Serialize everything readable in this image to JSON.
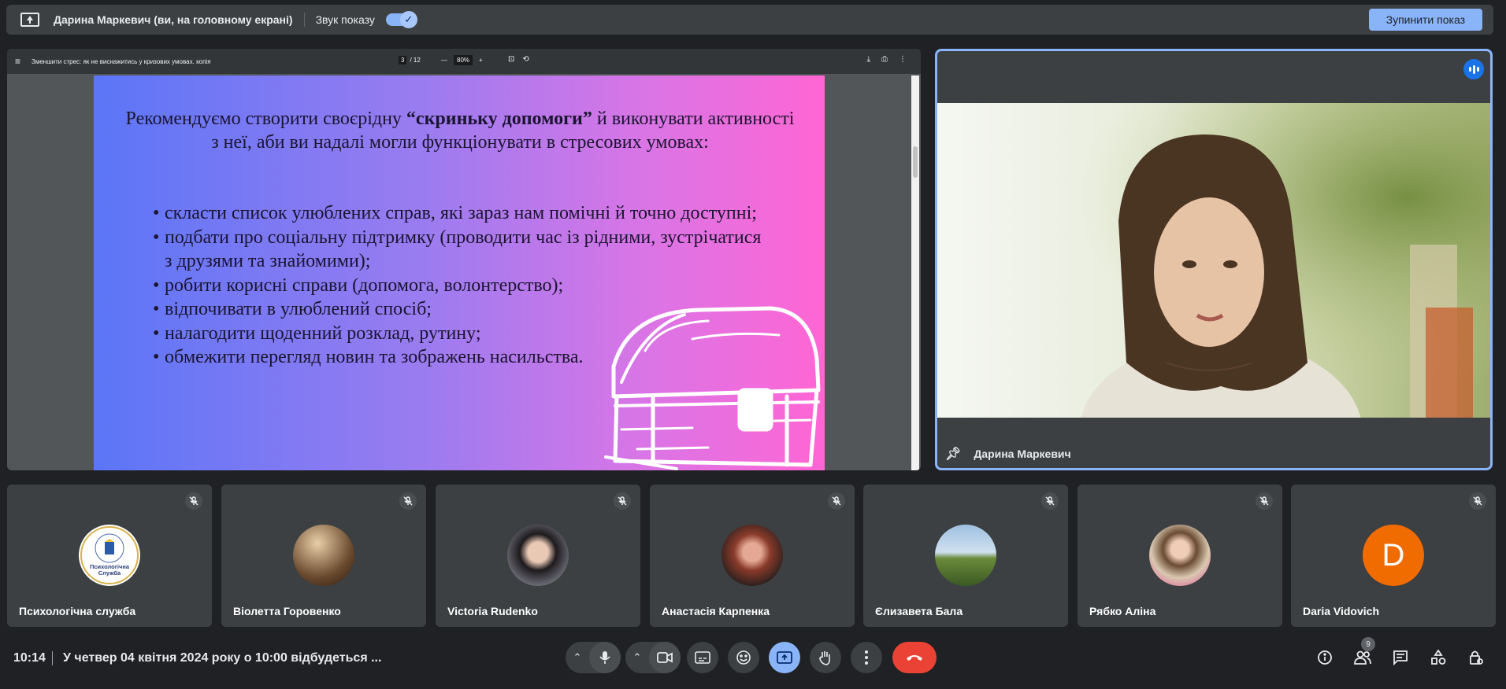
{
  "top_bar": {
    "presenter": "Дарина Маркевич (ви, на головному екрані)",
    "sound_label": "Звук показу",
    "sound_on": true,
    "stop_label": "Зупинити показ"
  },
  "pdf": {
    "title": "Зменшити стрес: як не виснажитись у кризових умовах. копія",
    "page_current": "3",
    "page_total": "/ 12",
    "zoom": "80%",
    "slide": {
      "intro_before": "Рекомендуємо створити своєрідну ",
      "intro_bold": "“скриньку допомоги”",
      "intro_after": " й виконувати активності з неї, аби ви надалі могли функціонувати в стресових умовах:",
      "bullets": [
        "скласти список улюблених справ, які зараз нам помічні й точно доступні;",
        "подбати про соціальну підтримку (проводити час із рідними, зустрічатися з друзями та знайомими);",
        "робити корисні справи (допомога, волонтерство);",
        "відпочивати в улюблений спосіб;",
        "налагодити щоденний розклад, рутину;",
        "обмежити перегляд новин та зображень насильства."
      ]
    }
  },
  "speaker": {
    "name": "Дарина Маркевич"
  },
  "participants": [
    {
      "name": "Психологічна служба",
      "avatar": "logo",
      "logo_text": "Психологічна Служба"
    },
    {
      "name": "Віолетта Горовенко",
      "avatar": "photo",
      "color": "#8a6a4a"
    },
    {
      "name": "Victoria Rudenko",
      "avatar": "photo",
      "color": "#6d6f7a"
    },
    {
      "name": "Анастасія Карпенка",
      "avatar": "photo",
      "color": "#4a3a38"
    },
    {
      "name": "Єлизавета Бала",
      "avatar": "photo",
      "color": "#7ea0c0"
    },
    {
      "name": "Рябко Аліна",
      "avatar": "photo",
      "color": "#9a8a70"
    },
    {
      "name": "Daria Vidovich",
      "avatar": "letter",
      "letter": "D",
      "color": "#f06b00"
    }
  ],
  "bottom_bar": {
    "time": "10:14",
    "meeting_title": "У четвер 04 квітня 2024 року о 10:00 відбудеться ...",
    "people_count": "9"
  },
  "colors": {
    "accent": "#8ab4f8",
    "end_call": "#ea4335",
    "tile_bg": "#3c4043",
    "page_bg": "#202124"
  }
}
